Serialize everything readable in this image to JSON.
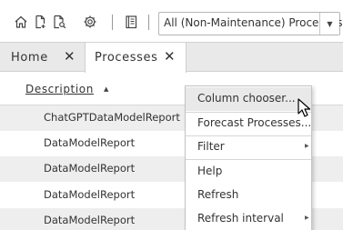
{
  "toolbar": {
    "icons": [
      "home-icon",
      "new-document-icon",
      "search-document-icon",
      "gear-icon",
      "book-icon"
    ],
    "filter_value": "All (Non-Maintenance) Processes"
  },
  "tabs": [
    {
      "label": "Home",
      "active": false
    },
    {
      "label": "Processes",
      "active": true
    }
  ],
  "table": {
    "column_header": "Description",
    "sort": "ascending",
    "rows": [
      "ChatGPTDataModelReport",
      "DataModelReport",
      "DataModelReport",
      "DataModelReport",
      "DataModelReport"
    ]
  },
  "context_menu": {
    "items": [
      {
        "label": "Column chooser...",
        "hovered": true,
        "submenu": false
      },
      {
        "label": "Forecast Processes...",
        "hovered": false,
        "submenu": false
      },
      {
        "label": "Filter",
        "hovered": false,
        "submenu": true
      },
      {
        "label": "Help",
        "hovered": false,
        "submenu": false
      },
      {
        "label": "Refresh",
        "hovered": false,
        "submenu": false
      },
      {
        "label": "Refresh interval",
        "hovered": false,
        "submenu": true
      }
    ]
  },
  "colors": {
    "tab_bar": "#e9e9e9",
    "row_shade": "#eeeeee",
    "menu_hover": "#e9e9e9"
  }
}
